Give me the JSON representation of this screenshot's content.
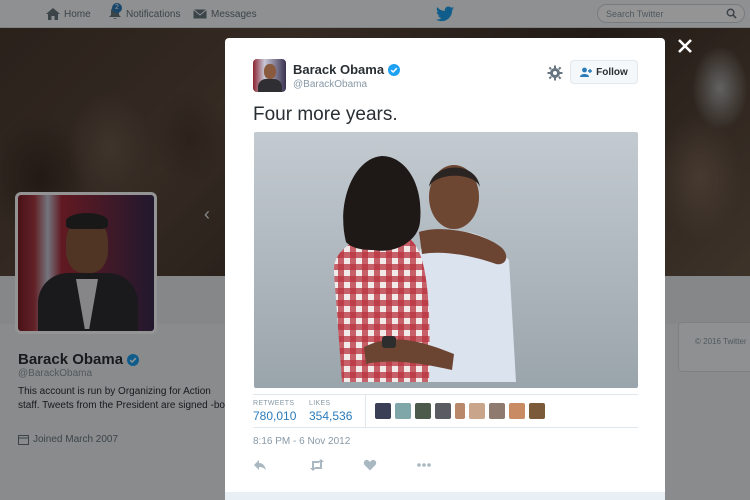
{
  "nav": {
    "home_label": "Home",
    "notifications_label": "Notifications",
    "notifications_badge": "2",
    "messages_label": "Messages",
    "search_placeholder": "Search Twitter"
  },
  "profile": {
    "name": "Barack Obama",
    "handle": "@BarackObama",
    "bio": "This account is run by Organizing for Action staff. Tweets from the President are signed -bo.",
    "joined": "Joined March 2007",
    "copyright": "© 2016 Twitter"
  },
  "tweet": {
    "author_name": "Barack Obama",
    "author_handle": "@BarackObama",
    "follow_label": "Follow",
    "text": "Four more years.",
    "retweets_label": "RETWEETS",
    "retweets_count": "780,010",
    "likes_label": "LIKES",
    "likes_count": "354,536",
    "timestamp": "8:16 PM - 6 Nov 2012"
  },
  "icons": {
    "home": "home-icon",
    "notifications": "bell-icon",
    "messages": "envelope-icon",
    "brand": "twitter-bird-icon",
    "search": "search-icon",
    "close": "close-icon",
    "verified": "verified-badge-icon",
    "settings": "gear-icon",
    "follow": "add-user-icon",
    "reply": "reply-icon",
    "retweet": "retweet-icon",
    "like": "heart-icon",
    "more": "more-icon",
    "calendar": "calendar-icon"
  },
  "colors": {
    "accent": "#2b7bb9",
    "verified": "#1da1f2",
    "text": "#292f33",
    "muted": "#8899a6"
  }
}
